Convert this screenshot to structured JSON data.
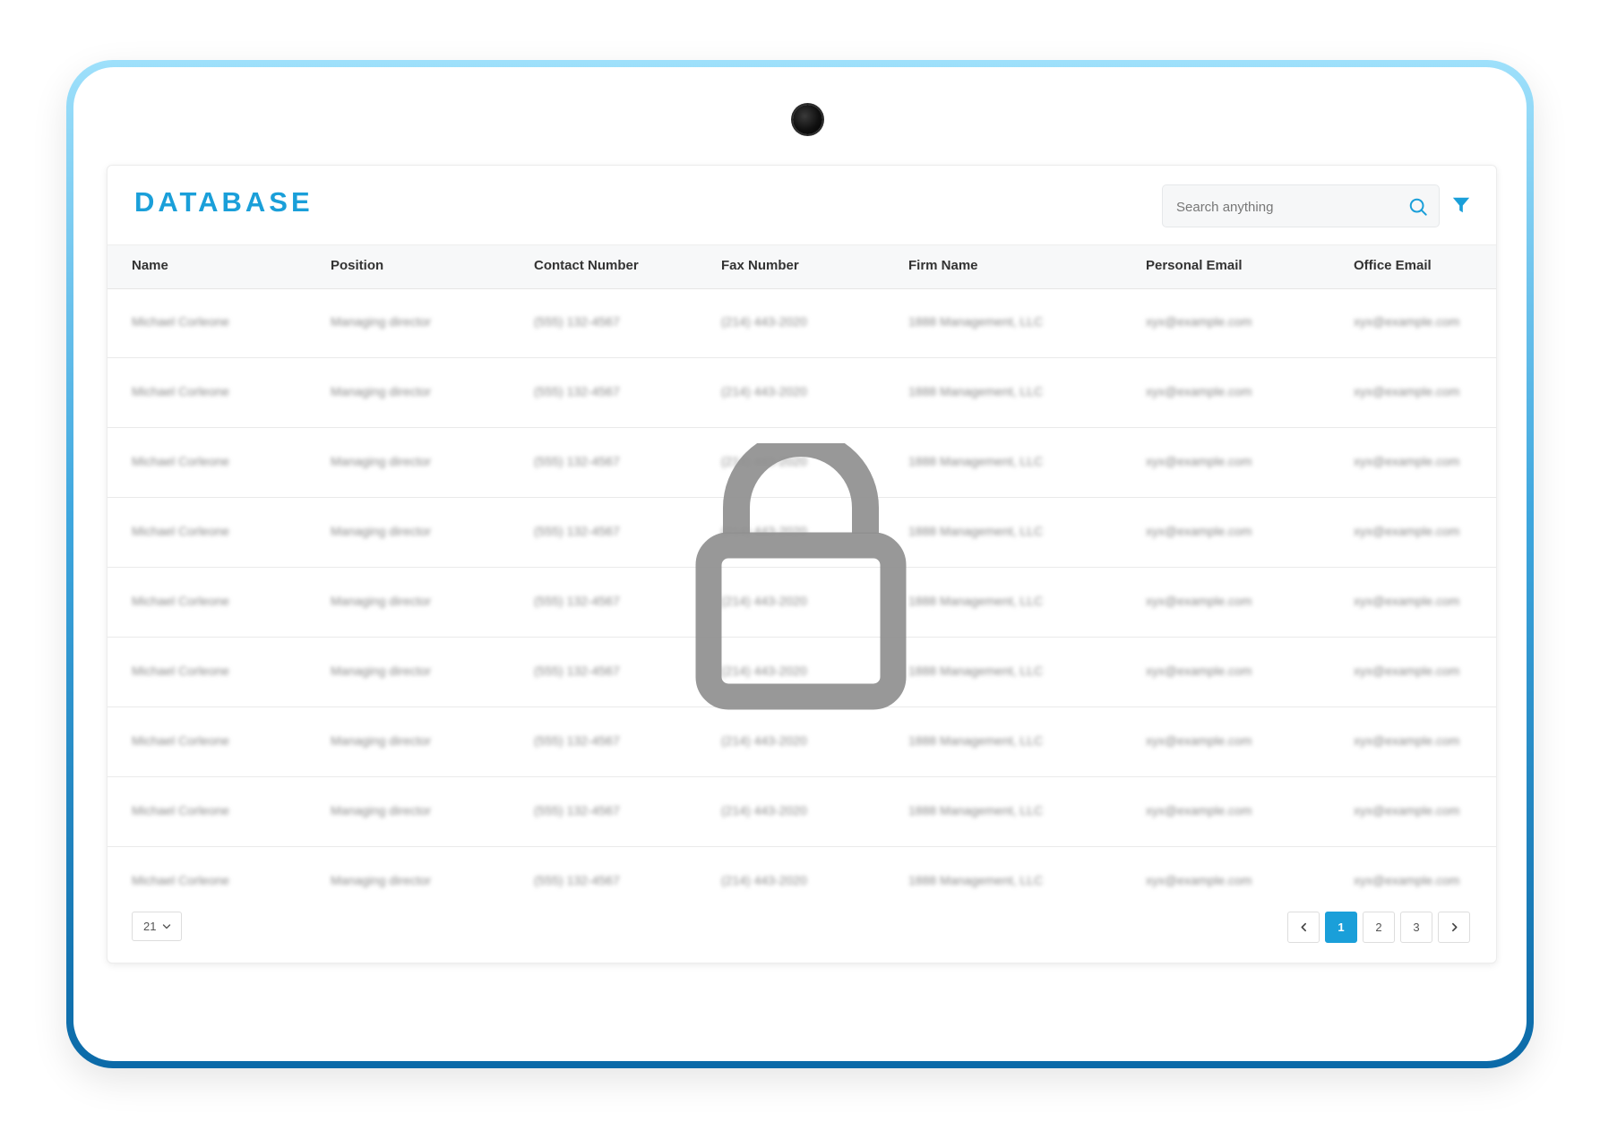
{
  "brand": {
    "logo_text": "DATABASE",
    "accent_color": "#1a9fd9"
  },
  "search": {
    "placeholder": "Search anything",
    "value": ""
  },
  "icons": {
    "search": "search-icon",
    "filter": "filter-icon",
    "lock": "lock-icon",
    "prev": "chevron-left-icon",
    "next": "chevron-right-icon",
    "dropdown": "chevron-down-icon"
  },
  "table": {
    "columns": [
      "Name",
      "Position",
      "Contact Number",
      "Fax Number",
      "Firm Name",
      "Personal Email",
      "Office Email"
    ],
    "rows": [
      [
        "Michael Corleone",
        "Managing director",
        "(555) 132-4567",
        "(214) 443-2020",
        "1888 Management, LLC",
        "xyx@example.com",
        "xyx@example.com"
      ],
      [
        "Michael Corleone",
        "Managing director",
        "(555) 132-4567",
        "(214) 443-2020",
        "1888 Management, LLC",
        "xyx@example.com",
        "xyx@example.com"
      ],
      [
        "Michael Corleone",
        "Managing director",
        "(555) 132-4567",
        "(214) 443-2020",
        "1888 Management, LLC",
        "xyx@example.com",
        "xyx@example.com"
      ],
      [
        "Michael Corleone",
        "Managing director",
        "(555) 132-4567",
        "(214) 443-2020",
        "1888 Management, LLC",
        "xyx@example.com",
        "xyx@example.com"
      ],
      [
        "Michael Corleone",
        "Managing director",
        "(555) 132-4567",
        "(214) 443-2020",
        "1888 Management, LLC",
        "xyx@example.com",
        "xyx@example.com"
      ],
      [
        "Michael Corleone",
        "Managing director",
        "(555) 132-4567",
        "(214) 443-2020",
        "1888 Management, LLC",
        "xyx@example.com",
        "xyx@example.com"
      ],
      [
        "Michael Corleone",
        "Managing director",
        "(555) 132-4567",
        "(214) 443-2020",
        "1888 Management, LLC",
        "xyx@example.com",
        "xyx@example.com"
      ],
      [
        "Michael Corleone",
        "Managing director",
        "(555) 132-4567",
        "(214) 443-2020",
        "1888 Management, LLC",
        "xyx@example.com",
        "xyx@example.com"
      ],
      [
        "Michael Corleone",
        "Managing director",
        "(555) 132-4567",
        "(214) 443-2020",
        "1888 Management, LLC",
        "xyx@example.com",
        "xyx@example.com"
      ]
    ]
  },
  "pagination": {
    "page_size": "21",
    "pages": [
      "1",
      "2",
      "3"
    ],
    "current_page": "1"
  }
}
